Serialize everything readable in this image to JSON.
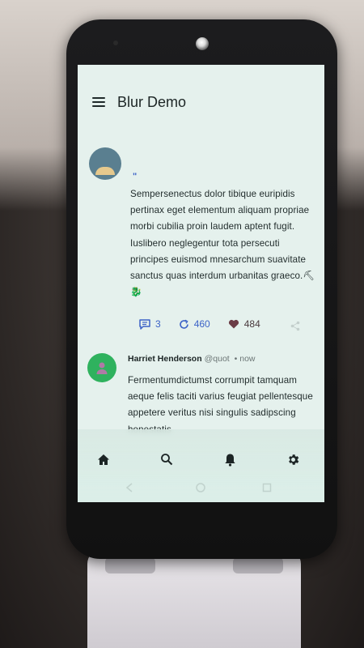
{
  "app": {
    "title": "Blur Demo"
  },
  "posts": [
    {
      "text": "Sempersenectus dolor tibique euripidis pertinax eget elementum aliquam propriae morbi cubilia proin laudem aptent fugit.  Iuslibero neglegentur tota persecuti principes euismod mnesarchum suavitate sanctus quas interdum urbanitas graeco.⛏🐉",
      "replies": "3",
      "reposts": "460",
      "likes": "484"
    },
    {
      "author": "Harriet Henderson",
      "handle": "@quot",
      "time": "• now",
      "text": "Fermentumdictumst corrumpit tamquam aeque felis taciti varius feugiat pellentesque appetere veritus nisi singulis sadipscing honestatis"
    }
  ],
  "icons": {
    "menu": "menu-icon",
    "reply": "chat-bubble-icon",
    "repost": "repost-icon",
    "like": "heart-icon",
    "share": "share-icon",
    "home": "home-icon",
    "search": "search-icon",
    "notifications": "bell-icon",
    "settings": "gear-icon"
  },
  "colors": {
    "accent": "#3c63c7",
    "like": "#6b3c46",
    "avatar_green": "#2fb25e",
    "screen_bg": "#e5f1ed"
  }
}
